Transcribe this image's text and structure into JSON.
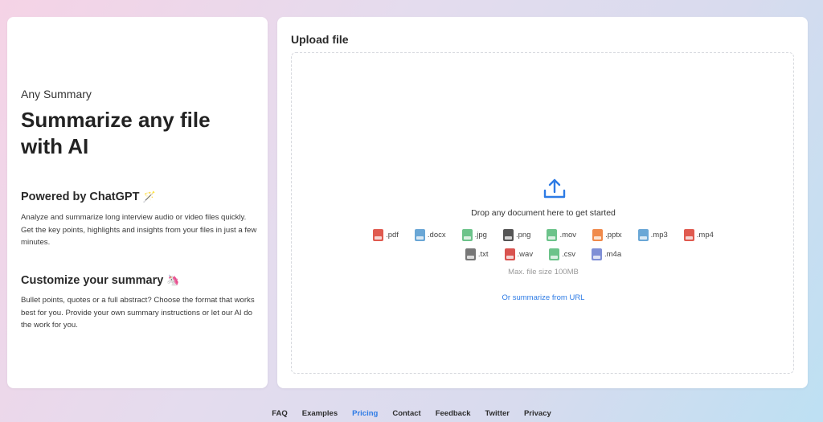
{
  "left": {
    "brand": "Any Summary",
    "headline": "Summarize any file with AI",
    "sections": [
      {
        "title": "Powered by ChatGPT",
        "emoji": "🪄",
        "text": "Analyze and summarize long interview audio or video files quickly. Get the key points, highlights and insights from your files in just a few minutes."
      },
      {
        "title": "Customize your summary",
        "emoji": "🦄",
        "text": "Bullet points, quotes or a full abstract? Choose the format that works best for you. Provide your own summary instructions or let our AI do the work for you."
      }
    ]
  },
  "upload": {
    "title": "Upload file",
    "icon": "upload-icon",
    "drop_text": "Drop any document here to get started",
    "file_types_row1": [
      {
        "label": ".pdf",
        "color": "#e05a4f"
      },
      {
        "label": ".docx",
        "color": "#6aa7d6"
      },
      {
        "label": ".jpg",
        "color": "#6cc38a"
      },
      {
        "label": ".png",
        "color": "#555555"
      },
      {
        "label": ".mov",
        "color": "#6cc38a"
      },
      {
        "label": ".pptx",
        "color": "#f08a4b"
      },
      {
        "label": ".mp3",
        "color": "#6aa7d6"
      },
      {
        "label": ".mp4",
        "color": "#e05a4f"
      }
    ],
    "file_types_row2": [
      {
        "label": ".txt",
        "color": "#777777"
      },
      {
        "label": ".wav",
        "color": "#d9534f"
      },
      {
        "label": ".csv",
        "color": "#6cc38a"
      },
      {
        "label": ".m4a",
        "color": "#7f8fd6"
      }
    ],
    "max_size": "Max. file size 100MB",
    "url_link": "Or summarize from URL"
  },
  "footer": {
    "links": [
      "FAQ",
      "Examples",
      "Pricing",
      "Contact",
      "Feedback",
      "Twitter",
      "Privacy"
    ],
    "active": "Pricing"
  },
  "colors": {
    "accent": "#2d7be5"
  }
}
